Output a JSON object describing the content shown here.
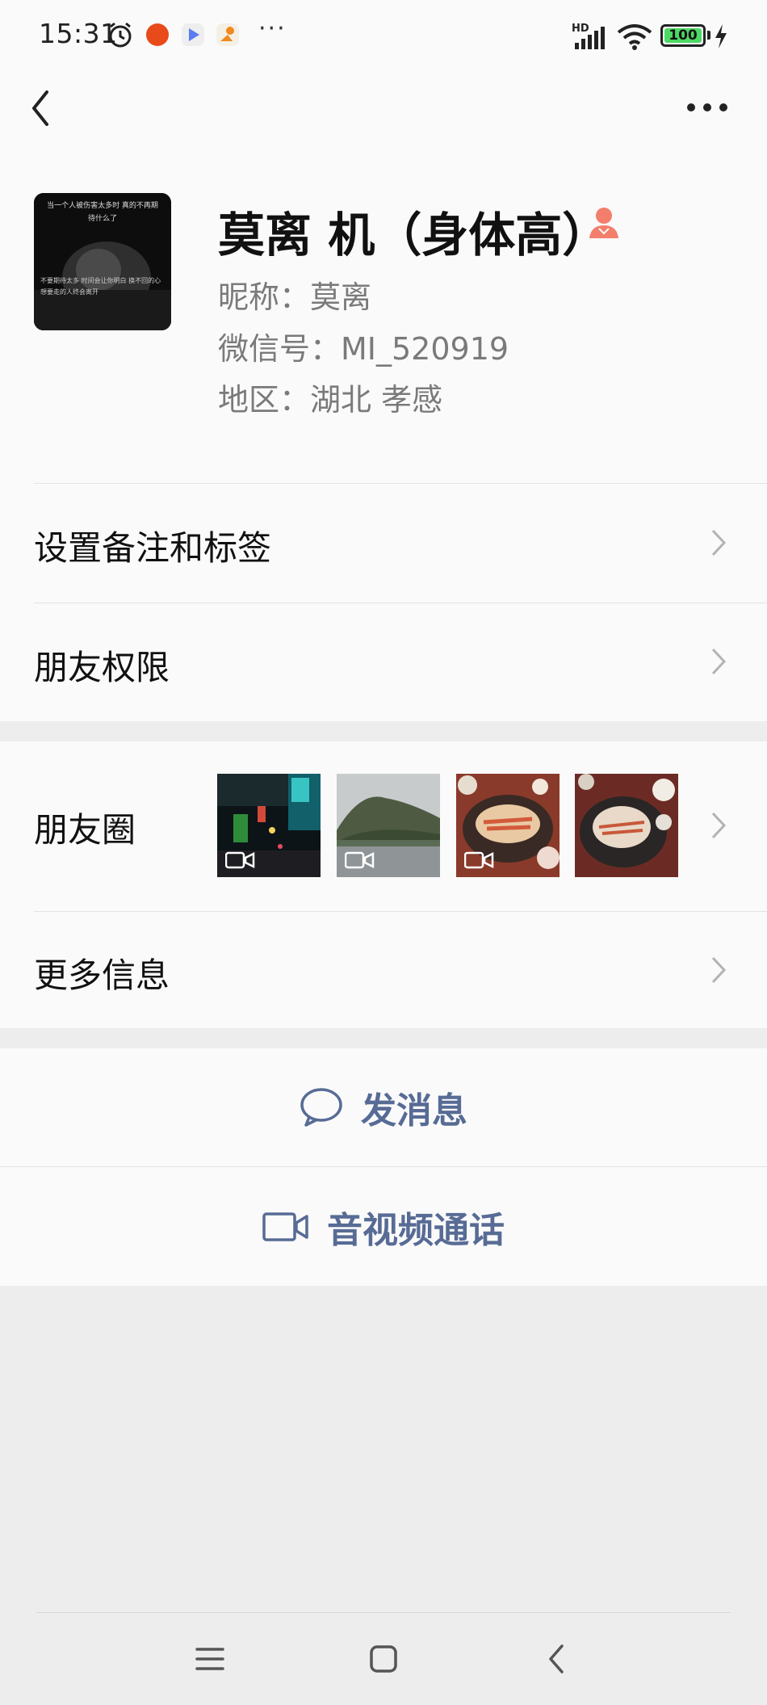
{
  "status_bar": {
    "time": "15:31",
    "more": "···",
    "network": "HD",
    "battery": "100",
    "icons": [
      "alarm-icon",
      "app-icon",
      "video-app-icon",
      "delivery-app-icon",
      "signal-icon",
      "wifi-icon",
      "charging-icon"
    ]
  },
  "nav": {
    "back_icon": "back-chevron-icon",
    "more_icon": "more-dots-icon"
  },
  "profile": {
    "display_name": "莫离 机（身体高）",
    "nickname_line": "昵称：莫离",
    "wechat_id_line": "微信号：MI_520919",
    "region_line": "地区：湖北  孝感",
    "gender": "female",
    "gender_color": "#f37e6b",
    "avatar_caption_top": "当一个人被伤害太多时 真的不再期待什么了",
    "avatar_caption_bottom": "不要期待太多 时间会让你明白 换不回的心 想要走的人终会离开"
  },
  "rows": {
    "remark_tags": "设置备注和标签",
    "permissions": "朋友权限",
    "moments": "朋友圈",
    "more_info": "更多信息"
  },
  "moments_thumbs": [
    {
      "name": "moments-thumb-night-street",
      "is_video": true
    },
    {
      "name": "moments-thumb-mountain",
      "is_video": true
    },
    {
      "name": "moments-thumb-food-plate",
      "is_video": true
    },
    {
      "name": "moments-thumb-food-table",
      "is_video": false
    }
  ],
  "actions": {
    "message": "发消息",
    "call": "音视频通话",
    "link_color": "#576b95"
  }
}
